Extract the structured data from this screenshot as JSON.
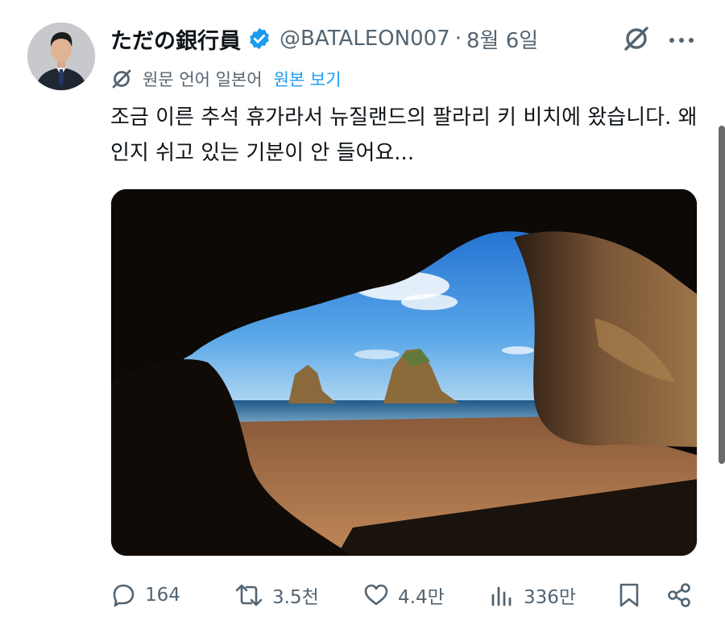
{
  "tweet": {
    "display_name": "ただの銀行員",
    "handle": "@BATALEON007",
    "separator": "·",
    "date": "8월 6일",
    "translation_label": "원문 언어 일본어",
    "view_original": "원본 보기",
    "text": "조금 이른 추석 휴가라서 뉴질랜드의 팔라리 키 비치에 왔습니다. 왜인지 쉬고 있는 기분이 안 들어요..."
  },
  "actions": {
    "replies": "164",
    "reposts": "3.5천",
    "likes": "4.4만",
    "views": "336만"
  },
  "icons": {
    "verified": "verified-badge-icon",
    "grok": "grok-icon",
    "more": "more-dots-icon",
    "reply": "reply-bubble-icon",
    "repost": "repost-icon",
    "like": "heart-icon",
    "views": "bar-chart-icon",
    "bookmark": "bookmark-icon",
    "share": "share-icon"
  },
  "colors": {
    "accent": "#1d9bf0",
    "secondary_text": "#536471",
    "primary_text": "#0f1419"
  }
}
